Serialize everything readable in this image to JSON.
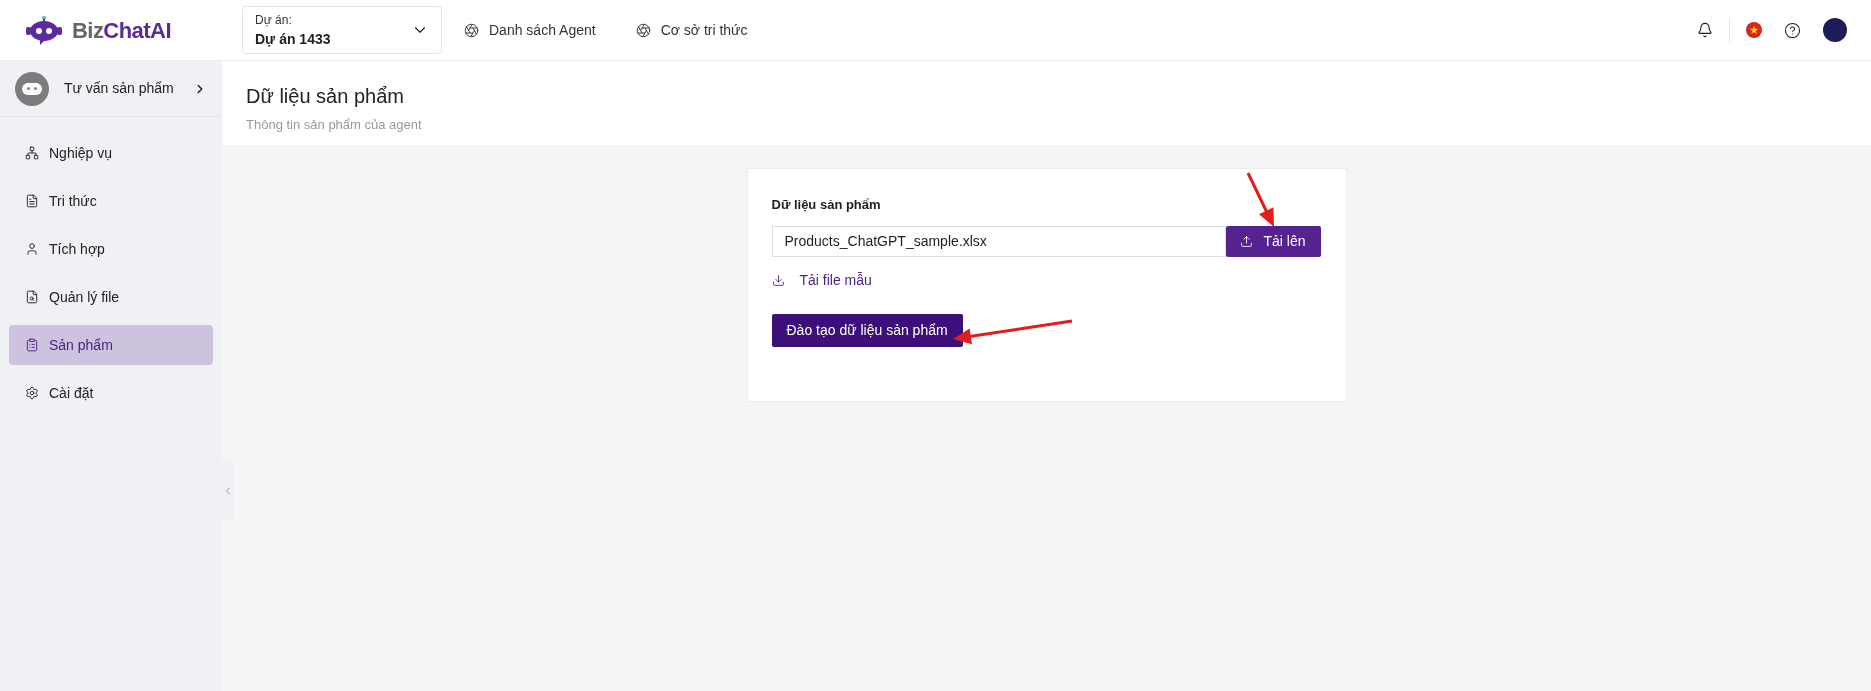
{
  "header": {
    "logo": {
      "part_1": "Biz",
      "part_2": "ChatAI"
    },
    "project": {
      "label": "Dự án:",
      "value": "Dự án 1433"
    },
    "nav": [
      {
        "label": "Danh sách Agent"
      },
      {
        "label": "Cơ sở tri thức"
      }
    ]
  },
  "sidebar": {
    "agent": "Tư vấn sản phẩm",
    "items": [
      {
        "label": "Nghiệp vụ",
        "selected": false
      },
      {
        "label": "Tri thức",
        "selected": false
      },
      {
        "label": "Tích hợp",
        "selected": false
      },
      {
        "label": "Quản lý file",
        "selected": false
      },
      {
        "label": "Sản phẩm",
        "selected": true
      },
      {
        "label": "Cài đặt",
        "selected": false
      }
    ]
  },
  "page": {
    "title": "Dữ liệu sản phẩm",
    "subtitle": "Thông tin sản phẩm của agent"
  },
  "card": {
    "label": "Dữ liệu sản phẩm",
    "file_value": "Products_ChatGPT_sample.xlsx",
    "upload_button": "Tải lên",
    "template_link": "Tải file mẫu",
    "train_button": "Đào tạo dữ liệu sản phẩm"
  }
}
